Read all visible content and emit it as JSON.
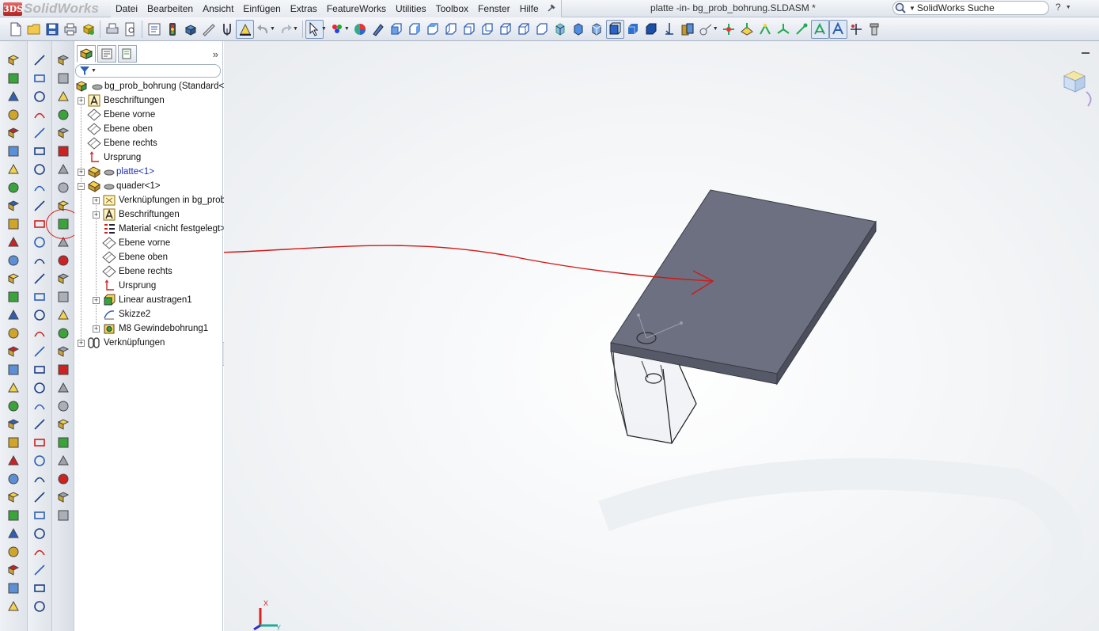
{
  "app": {
    "brand": "SolidWorks",
    "logo": "3DS"
  },
  "menu": [
    "Datei",
    "Bearbeiten",
    "Ansicht",
    "Einfügen",
    "Extras",
    "FeatureWorks",
    "Utilities",
    "Toolbox",
    "Fenster",
    "Hilfe"
  ],
  "document_title": "platte -in- bg_prob_bohrung.SLDASM *",
  "search": {
    "placeholder": "SolidWorks Suche"
  },
  "help_label": "?",
  "tree": {
    "root": "bg_prob_bohrung  (Standard<",
    "items": [
      {
        "label": "Beschriftungen",
        "icon": "annotations-icon",
        "expandable": true
      },
      {
        "label": "Ebene vorne",
        "icon": "plane-icon",
        "expandable": false
      },
      {
        "label": "Ebene oben",
        "icon": "plane-icon",
        "expandable": false
      },
      {
        "label": "Ebene rechts",
        "icon": "plane-icon",
        "expandable": false
      },
      {
        "label": "Ursprung",
        "icon": "origin-icon",
        "expandable": false
      },
      {
        "label": "platte<1>",
        "icon": "part-icon",
        "expandable": true,
        "selected": true
      },
      {
        "label": "quader<1>",
        "icon": "part-icon",
        "expandable": true,
        "expanded": true
      },
      {
        "label": "Verknüpfungen in bg_prob",
        "icon": "mates-icon",
        "expandable": true
      },
      {
        "label": "Beschriftungen",
        "icon": "annotations-icon",
        "expandable": true
      },
      {
        "label": "Material <nicht festgelegt>",
        "icon": "material-icon",
        "expandable": false
      },
      {
        "label": "Ebene vorne",
        "icon": "plane-icon",
        "expandable": false
      },
      {
        "label": "Ebene oben",
        "icon": "plane-icon",
        "expandable": false
      },
      {
        "label": "Ebene rechts",
        "icon": "plane-icon",
        "expandable": false
      },
      {
        "label": "Ursprung",
        "icon": "origin-icon",
        "expandable": false
      },
      {
        "label": "Linear austragen1",
        "icon": "extrude-icon",
        "expandable": true
      },
      {
        "label": "Skizze2",
        "icon": "sketch-icon",
        "expandable": false
      },
      {
        "label": "M8 Gewindebohrung1",
        "icon": "hole-icon",
        "expandable": true
      },
      {
        "label": "Verknüpfungen",
        "icon": "mates-icon",
        "expandable": true
      }
    ]
  },
  "triad": {
    "x_label": "X",
    "y_label": "Y"
  },
  "colors": {
    "plate_top": "#6d7080",
    "plate_edge": "#565967",
    "annotation": "#d01818",
    "menu_bg": "#e6eaf0"
  }
}
